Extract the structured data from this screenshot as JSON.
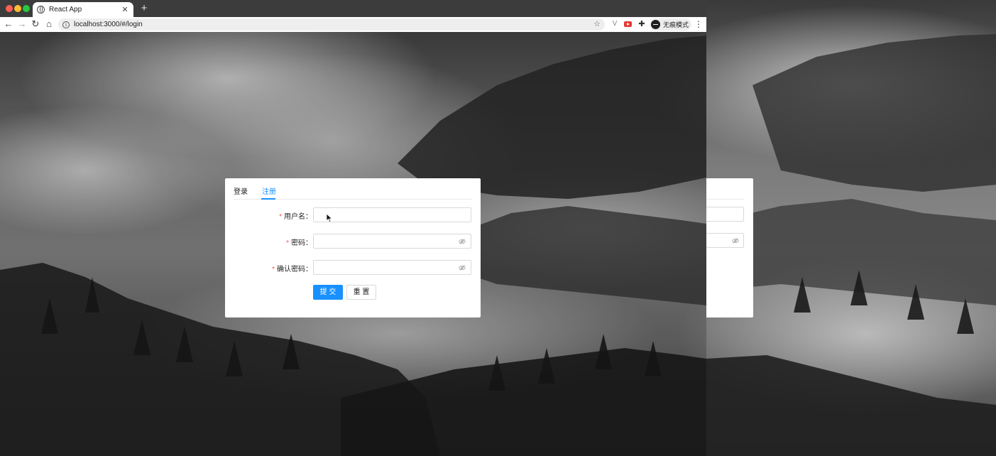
{
  "browser": {
    "tab_title": "React App",
    "tab_close": "✕",
    "new_tab": "+",
    "url": "localhost:3000/#/login",
    "incognito_label": "无痕模式",
    "nav": {
      "back": "←",
      "forward": "→",
      "reload": "↻",
      "home": "⌂",
      "menu": "⋮",
      "star": "☆",
      "info": "i"
    },
    "extensions": {
      "v_icon": "V",
      "puzzle_icon": "✚"
    }
  },
  "form": {
    "tabs": [
      {
        "label": "登录",
        "active": false
      },
      {
        "label": "注册",
        "active": true
      }
    ],
    "fields": [
      {
        "label": "用户名：",
        "required": true,
        "type": "text",
        "value": "",
        "placeholder": ""
      },
      {
        "label": "密码：",
        "required": true,
        "type": "password",
        "value": "",
        "placeholder": ""
      },
      {
        "label": "确认密码：",
        "required": true,
        "type": "password",
        "value": "",
        "placeholder": ""
      }
    ],
    "required_mark": "*",
    "submit_label": "提 交",
    "reset_label": "重 置"
  },
  "colors": {
    "accent": "#1890ff",
    "required": "#ff4d4f",
    "border": "#d9d9d9"
  }
}
